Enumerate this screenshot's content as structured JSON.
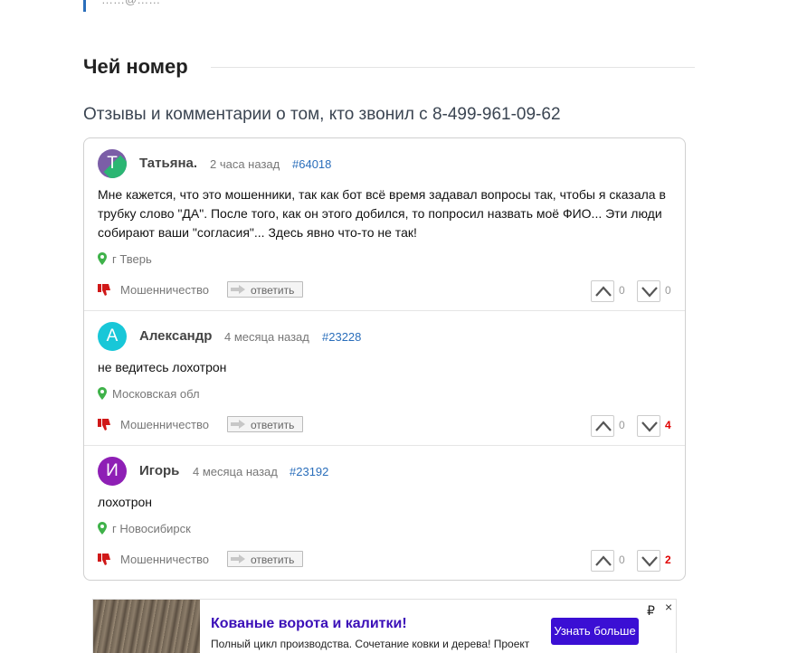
{
  "top_quote": {
    "text": "……@……"
  },
  "section": {
    "title": "Чей номер"
  },
  "subtitle": "Отзывы и комментарии о том, кто звонил с 8-499-961-09-62",
  "comments": [
    {
      "avatar_letter": "Т",
      "avatar_color": "#7b5ea7",
      "author": "Татьяна.",
      "time": "2 часа назад",
      "number": "#64018",
      "text": "Мне кажется, что это мошенники, так как бот всё время задавал вопросы так, чтобы я сказала в трубку слово \"ДА\". После того, как он этого добился, то попросил назвать моё ФИО... Эти люди собирают ваши \"согласия\"... Здесь явно что-то не так!",
      "location": "г Тверь",
      "category": "Мошенничество",
      "reply_label": "ответить",
      "votes_up": "0",
      "votes_down": "0"
    },
    {
      "avatar_letter": "А",
      "avatar_color": "#18c7d8",
      "author": "Александр",
      "time": "4 месяца назад",
      "number": "#23228",
      "text": "не ведитесь лохотрон",
      "location": "Московская обл",
      "category": "Мошенничество",
      "reply_label": "ответить",
      "votes_up": "0",
      "votes_down": "4"
    },
    {
      "avatar_letter": "И",
      "avatar_color": "#8e1fb5",
      "author": "Игорь",
      "time": "4 месяца назад",
      "number": "#23192",
      "text": "лохотрон",
      "location": "г Новосибирск",
      "category": "Мошенничество",
      "reply_label": "ответить",
      "votes_up": "0",
      "votes_down": "2"
    }
  ],
  "ad": {
    "title": "Кованые ворота и калитки!",
    "text": "Полный цикл производства. Сочетание ковки и дерева! Проект",
    "button": "Узнать больше",
    "currency": "₽",
    "close": "×"
  },
  "colors": {
    "link": "#2a6ebb",
    "negative": "#e00000",
    "ad_accent": "#3b0fd4"
  }
}
